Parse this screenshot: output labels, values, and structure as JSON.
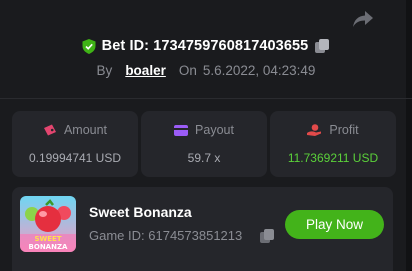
{
  "bet": {
    "label": "Bet ID:",
    "id": "1734759760817403655",
    "by_label": "By",
    "user": "boaler",
    "on_label": "On",
    "date": "5.6.2022, 04:23:49"
  },
  "stats": [
    {
      "label": "Amount",
      "value": "0.19994741 USD",
      "icon": "wallet-icon"
    },
    {
      "label": "Payout",
      "value": "59.7 x",
      "icon": "card-icon"
    },
    {
      "label": "Profit",
      "value": "11.7369211 USD",
      "icon": "coins-hand-icon"
    }
  ],
  "game": {
    "title": "Sweet Bonanza",
    "id_label": "Game ID:",
    "id": "6174573851213",
    "play_label": "Play Now",
    "thumb_text": "SWEET\nBONANZA"
  },
  "colors": {
    "background": "#1a1b1e",
    "card": "#25262b",
    "accent_green": "#43b31a",
    "profit_green": "#5bd13a",
    "amount_icon": "#e3456f",
    "payout_icon": "#9b5cf6",
    "profit_icon": "#e24a4a"
  }
}
